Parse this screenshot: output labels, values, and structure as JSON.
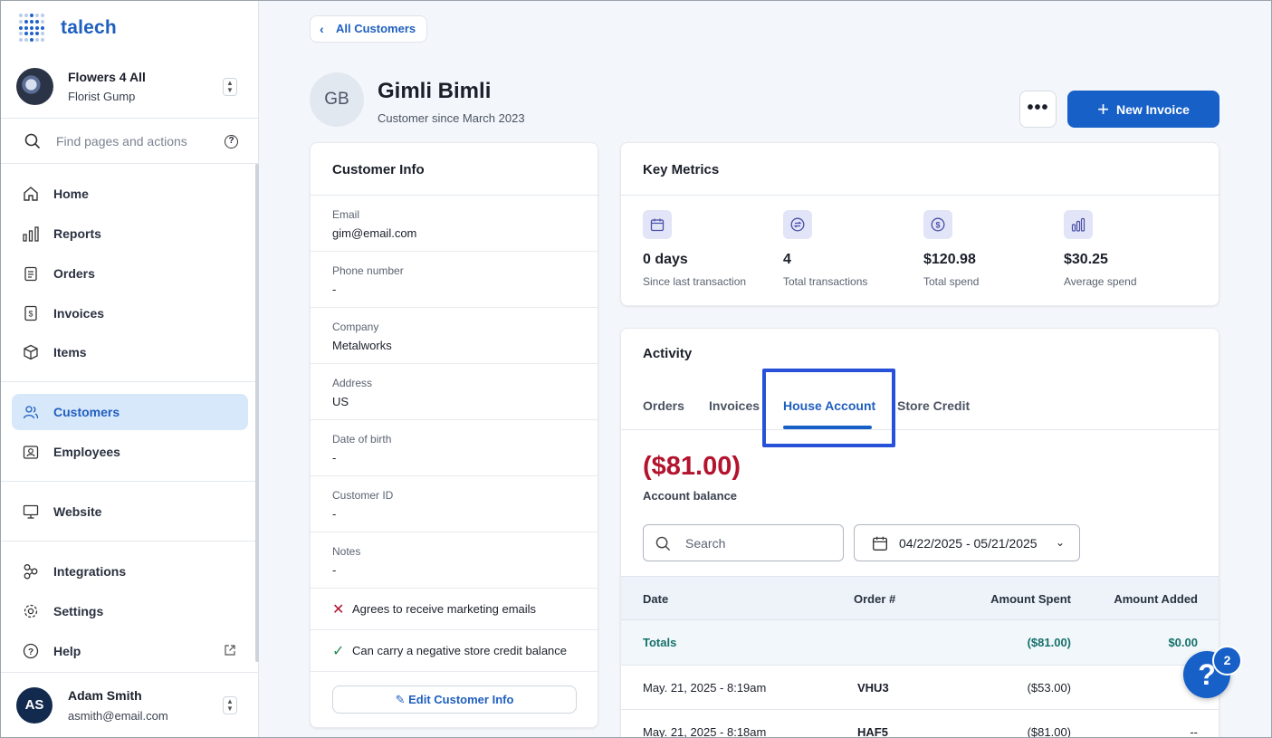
{
  "brand": {
    "name": "talech"
  },
  "store": {
    "name": "Flowers 4 All",
    "owner": "Florist Gump"
  },
  "nav_search": {
    "placeholder": "Find pages and actions"
  },
  "nav": {
    "items": [
      {
        "label": "Home",
        "icon": "home-icon"
      },
      {
        "label": "Reports",
        "icon": "bar-chart-icon"
      },
      {
        "label": "Orders",
        "icon": "clipboard-icon"
      },
      {
        "label": "Invoices",
        "icon": "invoice-icon"
      },
      {
        "label": "Items",
        "icon": "box-icon"
      },
      {
        "label": "Customers",
        "icon": "users-icon",
        "active": true
      },
      {
        "label": "Employees",
        "icon": "id-badge-icon"
      },
      {
        "label": "Website",
        "icon": "monitor-icon"
      },
      {
        "label": "Integrations",
        "icon": "integrations-icon"
      },
      {
        "label": "Settings",
        "icon": "gear-icon"
      },
      {
        "label": "Help",
        "icon": "question-icon"
      }
    ]
  },
  "user": {
    "initials": "AS",
    "name": "Adam Smith",
    "email": "asmith@email.com"
  },
  "header": {
    "back_label": "All Customers",
    "customer_initials": "GB",
    "customer_name": "Gimli Bimli",
    "customer_since": "Customer since March 2023",
    "more_label": "•••",
    "new_invoice_label": "New Invoice"
  },
  "customer_info": {
    "title": "Customer Info",
    "fields": [
      {
        "label": "Email",
        "value": "gim@email.com"
      },
      {
        "label": "Phone number",
        "value": "-"
      },
      {
        "label": "Company",
        "value": "Metalworks"
      },
      {
        "label": "Address",
        "value": "US"
      },
      {
        "label": "Date of birth",
        "value": "-"
      },
      {
        "label": "Customer ID",
        "value": "-"
      },
      {
        "label": "Notes",
        "value": "-"
      }
    ],
    "flags": [
      {
        "text": "Agrees to receive marketing emails",
        "state": "no",
        "icon": "x-icon"
      },
      {
        "text": "Can carry a negative store credit balance",
        "state": "yes",
        "icon": "check-icon"
      }
    ],
    "edit_label": "Edit Customer Info"
  },
  "key_metrics": {
    "title": "Key Metrics",
    "items": [
      {
        "value": "0 days",
        "label": "Since last transaction",
        "icon": "calendar-icon"
      },
      {
        "value": "4",
        "label": "Total transactions",
        "icon": "exchange-icon"
      },
      {
        "value": "$120.98",
        "label": "Total spend",
        "icon": "dollar-icon"
      },
      {
        "value": "$30.25",
        "label": "Average spend",
        "icon": "bar-chart-icon"
      }
    ]
  },
  "activity": {
    "title": "Activity",
    "tabs": [
      "Orders",
      "Invoices",
      "House Account",
      "Store Credit"
    ],
    "active_tab": "House Account",
    "balance": "($81.00)",
    "balance_label": "Account balance",
    "search_placeholder": "Search",
    "date_range": "04/22/2025 - 05/21/2025",
    "columns": [
      "Date",
      "Order #",
      "Amount Spent",
      "Amount Added"
    ],
    "totals": {
      "label": "Totals",
      "spent": "($81.00)",
      "added": "$0.00"
    },
    "rows": [
      {
        "date": "May. 21, 2025 - 8:19am",
        "order": "VHU3",
        "spent": "($53.00)",
        "added": ""
      },
      {
        "date": "May. 21, 2025 - 8:18am",
        "order": "HAF5",
        "spent": "($81.00)",
        "added": "--"
      }
    ]
  },
  "help_widget": {
    "label": "?",
    "badge": "2"
  },
  "colors": {
    "accent": "#1760c8",
    "negative": "#b3132d",
    "totals": "#16706b",
    "highlight": "#2651d8"
  }
}
